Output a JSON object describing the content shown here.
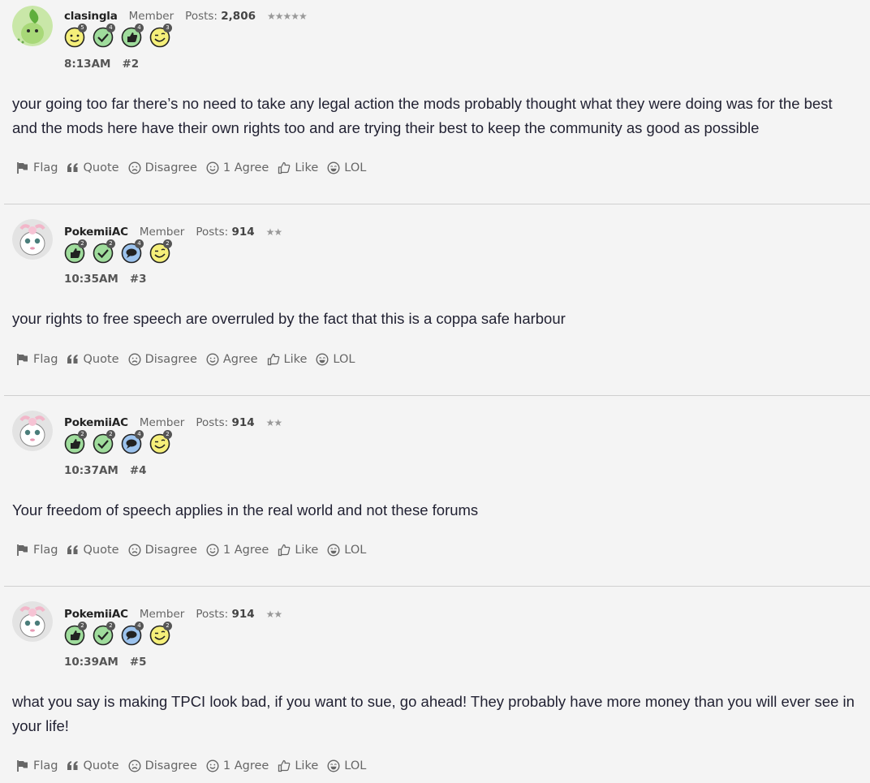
{
  "posts": [
    {
      "username": "clasingla",
      "role": "Member",
      "posts_label": "Posts:",
      "posts_count": "2,806",
      "stars": "★★★★★",
      "badges": [
        {
          "icon": "smiley-face-badge-icon",
          "count": "5"
        },
        {
          "icon": "checkmark-badge-icon",
          "count": "4"
        },
        {
          "icon": "thumbs-up-badge-icon",
          "count": "4"
        },
        {
          "icon": "wink-face-badge-icon",
          "count": "3"
        }
      ],
      "time": "8:13AM",
      "number": "#2",
      "body": "your going too far there’s no need to take any legal action the mods probably thought what they were doing was for the best and the mods here have their own rights too and are trying their best to keep the community as good as possible",
      "actions": {
        "flag": "Flag",
        "quote": "Quote",
        "disagree": "Disagree",
        "agree": "1 Agree",
        "like": "Like",
        "lol": "LOL"
      }
    },
    {
      "username": "PokemiiAC",
      "role": "Member",
      "posts_label": "Posts:",
      "posts_count": "914",
      "stars": "★★",
      "badges": [
        {
          "icon": "thumbs-up-badge-icon",
          "count": "2"
        },
        {
          "icon": "checkmark-badge-icon",
          "count": "2"
        },
        {
          "icon": "speech-bubble-badge-icon",
          "count": "4"
        },
        {
          "icon": "wink-face-badge-icon",
          "count": "2"
        }
      ],
      "time": "10:35AM",
      "number": "#3",
      "body": "your rights to free speech are overruled by the fact that this is a coppa safe harbour",
      "actions": {
        "flag": "Flag",
        "quote": "Quote",
        "disagree": "Disagree",
        "agree": "Agree",
        "like": "Like",
        "lol": "LOL"
      }
    },
    {
      "username": "PokemiiAC",
      "role": "Member",
      "posts_label": "Posts:",
      "posts_count": "914",
      "stars": "★★",
      "badges": [
        {
          "icon": "thumbs-up-badge-icon",
          "count": "2"
        },
        {
          "icon": "checkmark-badge-icon",
          "count": "2"
        },
        {
          "icon": "speech-bubble-badge-icon",
          "count": "4"
        },
        {
          "icon": "wink-face-badge-icon",
          "count": "2"
        }
      ],
      "time": "10:37AM",
      "number": "#4",
      "body": "Your freedom of speech applies in the real world and not these forums",
      "actions": {
        "flag": "Flag",
        "quote": "Quote",
        "disagree": "Disagree",
        "agree": "1 Agree",
        "like": "Like",
        "lol": "LOL"
      }
    },
    {
      "username": "PokemiiAC",
      "role": "Member",
      "posts_label": "Posts:",
      "posts_count": "914",
      "stars": "★★",
      "badges": [
        {
          "icon": "thumbs-up-badge-icon",
          "count": "2"
        },
        {
          "icon": "checkmark-badge-icon",
          "count": "2"
        },
        {
          "icon": "speech-bubble-badge-icon",
          "count": "4"
        },
        {
          "icon": "wink-face-badge-icon",
          "count": "2"
        }
      ],
      "time": "10:39AM",
      "number": "#5",
      "body": "what you say is making TPCI look bad, if you want to sue, go ahead! They probably have more money than you will ever see in your life!",
      "actions": {
        "flag": "Flag",
        "quote": "Quote",
        "disagree": "Disagree",
        "agree": "1 Agree",
        "like": "Like",
        "lol": "LOL"
      }
    }
  ],
  "colors": {
    "background": "#f4f4f4",
    "divider": "#cfcfcf",
    "badge_yellow": "#f5ef7a",
    "badge_green": "#9fdc9c",
    "badge_blue": "#9cc3ee"
  }
}
